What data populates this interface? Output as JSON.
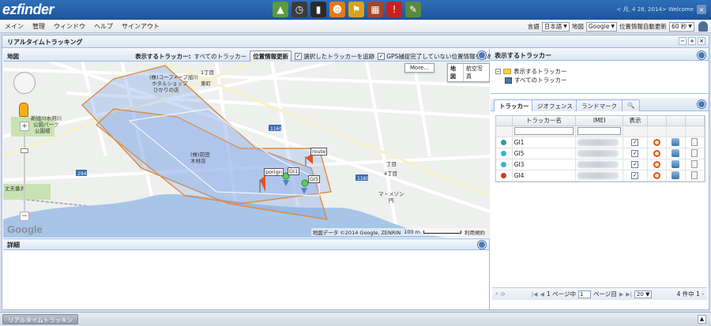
{
  "app": {
    "logo_text": "ezfinder",
    "header_info": "< 月, 4 28, 2014> Welcome",
    "close_label": "×"
  },
  "toolbar_icons": [
    {
      "icon": "map-icon",
      "color": "#5a9a3c",
      "glyph": "▲"
    },
    {
      "icon": "clock-icon",
      "color": "#3b3b3b",
      "glyph": "◷"
    },
    {
      "icon": "phone-icon",
      "color": "#2b2b2b",
      "glyph": "▮"
    },
    {
      "icon": "person-icon",
      "color": "#e27a1a",
      "glyph": "☻"
    },
    {
      "icon": "flag-icon",
      "color": "#d9a21a",
      "glyph": "⚑"
    },
    {
      "icon": "chart-icon",
      "color": "#a8442a",
      "glyph": "▦"
    },
    {
      "icon": "alert-icon",
      "color": "#c8201c",
      "glyph": "!"
    },
    {
      "icon": "report-icon",
      "color": "#5a8a3a",
      "glyph": "✎"
    }
  ],
  "menu": {
    "items": [
      "メイン",
      "管理",
      "ウィンドウ",
      "ヘルプ",
      "サインアウト"
    ],
    "language_label": "言語",
    "language_value": "日本語",
    "map_label": "地図",
    "map_value": "Google",
    "refresh_label": "位置情報自動更新",
    "refresh_value": "60 秒"
  },
  "main_panel": {
    "title": "リアルタイムトラッキング",
    "tool_minus": "−",
    "tool_plus": "+",
    "tool_close": "×"
  },
  "map_panel": {
    "title": "地図",
    "tracker_label": "表示するトラッカー:",
    "tracker_value": "すべてのトラッカー",
    "update_button": "位置情報更新",
    "follow_label": "選択したトラッカーを追跡",
    "gps_label": "GPS捕捉完了していない位置情報を含める",
    "more_button": "More...",
    "map_type_map": "地図",
    "map_type_satellite": "航空写真",
    "google_logo": "Google",
    "attribution": "地図データ ©2014 Google, ZENRIN",
    "scale": "100 m",
    "terms": "利用規約",
    "labels": [
      {
        "text": "(株)コープ×ープ旭川",
        "cls": "lbl-a"
      },
      {
        "text": "ホタルショップ",
        "cls": "lbl-b"
      },
      {
        "text": "ひかりの店",
        "cls": "lbl-c"
      },
      {
        "text": "1丁目",
        "cls": "lbl-d"
      },
      {
        "text": "東町",
        "cls": "lbl-e"
      },
      {
        "text": "新旭川水河川",
        "cls": "lbl-f"
      },
      {
        "text": "公園パーク",
        "cls": "lbl-g"
      },
      {
        "text": "公園場",
        "cls": "lbl-h"
      },
      {
        "text": "(株)前田",
        "cls": "lbl-i"
      },
      {
        "text": "木材店",
        "cls": "lbl-j"
      },
      {
        "text": "4丁目",
        "cls": "lbl-k"
      },
      {
        "text": "マ・メゾン",
        "cls": "lbl-l"
      },
      {
        "text": "円",
        "cls": "lbl-m"
      },
      {
        "text": "丁目",
        "cls": "lbl-n"
      },
      {
        "text": "丈夫番丸",
        "cls": "lbl-o"
      }
    ],
    "road_shields": [
      "294",
      "1160",
      "1160"
    ],
    "flags": {
      "origin": "porign",
      "route": "route",
      "gi1": "GI1",
      "gi5": "GI5"
    }
  },
  "details_panel": {
    "title": "詳細"
  },
  "tracker_panel": {
    "title": "表示するトラッカー",
    "tree_root": "表示するトラッカー",
    "tree_child": "すべてのトラッカー"
  },
  "tabs": [
    "トラッカー",
    "ジオフェンス",
    "ランドマーク"
  ],
  "grid": {
    "headers": {
      "name": "トラッカー名",
      "imei": "IMEI",
      "show": "表示"
    },
    "rows": [
      {
        "name": "GI1",
        "dot": "#2d9c9c",
        "checked": "✓"
      },
      {
        "name": "GI5",
        "dot": "#36b6c8",
        "checked": "✓"
      },
      {
        "name": "GI3",
        "dot": "#36b6c8",
        "checked": "✓"
      },
      {
        "name": "GI4",
        "dot": "#c04020",
        "checked": "✓"
      }
    ]
  },
  "pager": {
    "page_of": "1 ページ中",
    "current_page": "1",
    "page_suffix": "ページ目",
    "page_size": "20",
    "total": "4 件中 1 -"
  },
  "taskbar": {
    "task_label": "リアルタイムトラッキン"
  }
}
